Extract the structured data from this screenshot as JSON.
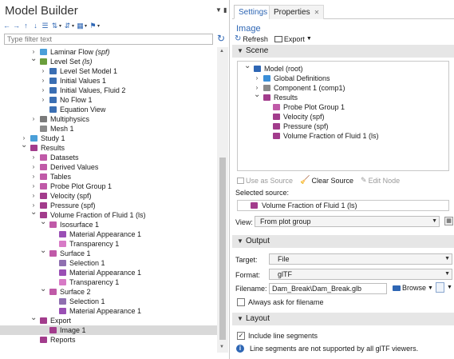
{
  "model_builder": {
    "title": "Model Builder",
    "filter_placeholder": "Type filter text",
    "tree": [
      {
        "label": "Laminar Flow",
        "suffix": " (spf)",
        "italic_suffix": true,
        "indent": 2,
        "twisty": "collapsed",
        "icon": "laminar-flow-icon",
        "icon_color": "#4a9fd8"
      },
      {
        "label": "Level Set",
        "suffix": " (ls)",
        "italic_suffix": true,
        "indent": 2,
        "twisty": "expanded",
        "icon": "level-set-icon",
        "icon_color": "#6a9e3c"
      },
      {
        "label": "Level Set Model 1",
        "suffix": "",
        "indent": 3,
        "twisty": "collapsed",
        "icon": "level-set-model-icon",
        "icon_color": "#3b6fb3"
      },
      {
        "label": "Initial Values 1",
        "suffix": "",
        "indent": 3,
        "twisty": "collapsed",
        "icon": "initial-values-icon",
        "icon_color": "#3b6fb3"
      },
      {
        "label": "Initial Values, Fluid 2",
        "suffix": "",
        "indent": 3,
        "twisty": "collapsed",
        "icon": "initial-values-icon",
        "icon_color": "#3b6fb3"
      },
      {
        "label": "No Flow 1",
        "suffix": "",
        "indent": 3,
        "twisty": "collapsed",
        "icon": "no-flow-icon",
        "icon_color": "#3b6fb3"
      },
      {
        "label": "Equation View",
        "suffix": "",
        "indent": 3,
        "twisty": "none",
        "icon": "equation-view-icon",
        "icon_color": "#3b6fb3"
      },
      {
        "label": "Multiphysics",
        "suffix": "",
        "indent": 2,
        "twisty": "collapsed",
        "icon": "multiphysics-icon",
        "icon_color": "#7a7a7a"
      },
      {
        "label": "Mesh 1",
        "suffix": "",
        "indent": 2,
        "twisty": "none",
        "icon": "mesh-icon",
        "icon_color": "#8a8a8a"
      },
      {
        "label": "Study 1",
        "suffix": "",
        "indent": 1,
        "twisty": "collapsed",
        "icon": "study-icon",
        "icon_color": "#4a9fd8"
      },
      {
        "label": "Results",
        "suffix": "",
        "indent": 1,
        "twisty": "expanded",
        "icon": "results-icon",
        "icon_color": "#a23c8c"
      },
      {
        "label": "Datasets",
        "suffix": "",
        "indent": 2,
        "twisty": "collapsed",
        "icon": "datasets-icon",
        "icon_color": "#c05aa8"
      },
      {
        "label": "Derived Values",
        "suffix": "",
        "indent": 2,
        "twisty": "collapsed",
        "icon": "derived-values-icon",
        "icon_color": "#c05aa8"
      },
      {
        "label": "Tables",
        "suffix": "",
        "indent": 2,
        "twisty": "collapsed",
        "icon": "tables-icon",
        "icon_color": "#c05aa8"
      },
      {
        "label": "Probe Plot Group 1",
        "suffix": "",
        "indent": 2,
        "twisty": "collapsed",
        "icon": "probe-plot-icon",
        "icon_color": "#c05aa8"
      },
      {
        "label": "Velocity (spf)",
        "suffix": "",
        "indent": 2,
        "twisty": "collapsed",
        "icon": "plot-group-icon",
        "icon_color": "#a23c8c"
      },
      {
        "label": "Pressure (spf)",
        "suffix": "",
        "indent": 2,
        "twisty": "collapsed",
        "icon": "plot-group-icon",
        "icon_color": "#a23c8c"
      },
      {
        "label": "Volume Fraction of Fluid 1 (ls)",
        "suffix": "",
        "indent": 2,
        "twisty": "expanded",
        "icon": "plot-group-icon",
        "icon_color": "#a23c8c"
      },
      {
        "label": "Isosurface 1",
        "suffix": "",
        "indent": 3,
        "twisty": "expanded",
        "icon": "isosurface-icon",
        "icon_color": "#c05aa8"
      },
      {
        "label": "Material Appearance 1",
        "suffix": "",
        "indent": 4,
        "twisty": "none",
        "icon": "material-appearance-icon",
        "icon_color": "#9a4fb5"
      },
      {
        "label": "Transparency 1",
        "suffix": "",
        "indent": 4,
        "twisty": "none",
        "icon": "transparency-icon",
        "icon_color": "#d77ac6"
      },
      {
        "label": "Surface 1",
        "suffix": "",
        "indent": 3,
        "twisty": "expanded",
        "icon": "surface-icon",
        "icon_color": "#c05aa8"
      },
      {
        "label": "Selection 1",
        "suffix": "",
        "indent": 4,
        "twisty": "none",
        "icon": "selection-icon",
        "icon_color": "#8f6fb0"
      },
      {
        "label": "Material Appearance 1",
        "suffix": "",
        "indent": 4,
        "twisty": "none",
        "icon": "material-appearance-icon",
        "icon_color": "#9a4fb5"
      },
      {
        "label": "Transparency 1",
        "suffix": "",
        "indent": 4,
        "twisty": "none",
        "icon": "transparency-icon",
        "icon_color": "#d77ac6"
      },
      {
        "label": "Surface 2",
        "suffix": "",
        "indent": 3,
        "twisty": "expanded",
        "icon": "surface-icon",
        "icon_color": "#c05aa8"
      },
      {
        "label": "Selection 1",
        "suffix": "",
        "indent": 4,
        "twisty": "none",
        "icon": "selection-icon",
        "icon_color": "#8f6fb0"
      },
      {
        "label": "Material Appearance 1",
        "suffix": "",
        "indent": 4,
        "twisty": "none",
        "icon": "material-appearance-icon",
        "icon_color": "#9a4fb5"
      },
      {
        "label": "Export",
        "suffix": "",
        "indent": 2,
        "twisty": "expanded",
        "icon": "export-icon",
        "icon_color": "#a23c8c"
      },
      {
        "label": "Image 1",
        "suffix": "",
        "indent": 3,
        "twisty": "none",
        "icon": "image-icon",
        "icon_color": "#a23c8c",
        "selected": true
      },
      {
        "label": "Reports",
        "suffix": "",
        "indent": 2,
        "twisty": "none",
        "icon": "reports-icon",
        "icon_color": "#a23c8c"
      }
    ]
  },
  "settings": {
    "tabs": {
      "settings": "Settings",
      "properties": "Properties"
    },
    "node_type": "Image",
    "refresh_label": "Refresh",
    "export_label": "Export",
    "scene": {
      "title": "Scene",
      "tree": [
        {
          "label": "Model (root)",
          "indent": 0,
          "twisty": "expanded",
          "icon": "model-root-icon",
          "icon_color": "#2e66b4"
        },
        {
          "label": "Global Definitions",
          "indent": 1,
          "twisty": "collapsed",
          "icon": "global-definitions-icon",
          "icon_color": "#3b8fd8"
        },
        {
          "label": "Component 1 (comp1)",
          "indent": 1,
          "twisty": "collapsed",
          "icon": "component-icon",
          "icon_color": "#8a8a8a"
        },
        {
          "label": "Results",
          "indent": 1,
          "twisty": "expanded",
          "icon": "results-icon",
          "icon_color": "#a23c8c"
        },
        {
          "label": "Probe Plot Group 1",
          "indent": 2,
          "twisty": "none",
          "icon": "probe-plot-icon",
          "icon_color": "#c05aa8"
        },
        {
          "label": "Velocity (spf)",
          "indent": 2,
          "twisty": "none",
          "icon": "plot-group-icon",
          "icon_color": "#a23c8c"
        },
        {
          "label": "Pressure (spf)",
          "indent": 2,
          "twisty": "none",
          "icon": "plot-group-icon",
          "icon_color": "#a23c8c"
        },
        {
          "label": "Volume Fraction of Fluid 1 (ls)",
          "indent": 2,
          "twisty": "none",
          "icon": "plot-group-icon",
          "icon_color": "#a23c8c"
        }
      ],
      "use_as_source": "Use as Source",
      "clear_source": "Clear Source",
      "edit_node": "Edit Node",
      "selected_source_label": "Selected source:",
      "selected_source_value": "Volume Fraction of Fluid 1 (ls)",
      "view_label": "View:",
      "view_value": "From plot group"
    },
    "output": {
      "title": "Output",
      "target_label": "Target:",
      "target_value": "File",
      "format_label": "Format:",
      "format_value": "glTF",
      "filename_label": "Filename:",
      "filename_value": "Dam_Break\\Dam_Break.glb",
      "browse_label": "Browse",
      "always_ask_label": "Always ask for filename",
      "always_ask_checked": false
    },
    "layout": {
      "title": "Layout",
      "include_line_segments_label": "Include line segments",
      "include_line_segments_checked": true,
      "info_text": "Line segments are not supported by all glTF viewers."
    }
  }
}
